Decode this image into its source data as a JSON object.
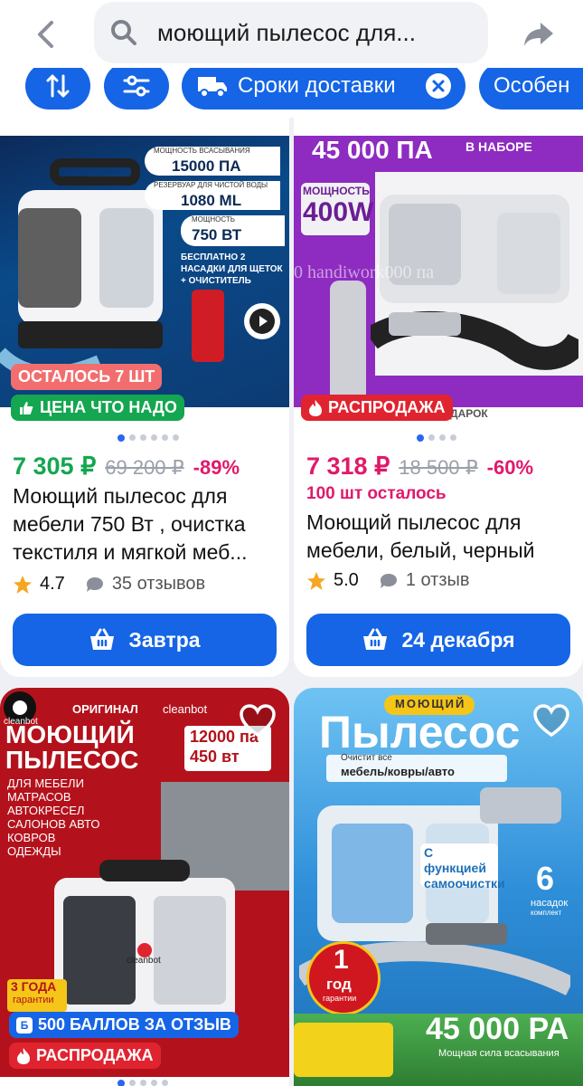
{
  "search": {
    "query": "моющий пылесос для..."
  },
  "filters": [
    {
      "label": ""
    },
    {
      "label": ""
    },
    {
      "label": "Сроки доставки"
    },
    {
      "label": "Особен"
    }
  ],
  "products": [
    {
      "image_texts": {
        "suction_label": "МОЩНОСТЬ ВСАСЫВАНИЯ",
        "suction": "15000 ПА",
        "tank_label": "РЕЗЕРВУАР ДЛЯ ЧИСТОЙ ВОДЫ",
        "tank": "1080 ML",
        "power_label": "МОЩНОСТЬ",
        "power": "750 ВТ",
        "bonus": "БЕСПЛАТНО 2 НАСАДКИ ДЛЯ ЩЕТОК + ОЧИСТИТЕЛЬ"
      },
      "badge_top": "ОСТАЛОСЬ 7 ШТ",
      "badge_bottom": "ЦЕНА ЧТО НАДО",
      "price": "7 305 ₽",
      "old_price": "69 200 ₽",
      "discount": "-89%",
      "title": "Моющий пылесос для мебели 750 Вт , очистка текстиля и мягкой меб...",
      "rating": "4.7",
      "reviews": "35 отзывов",
      "delivery": "Завтра"
    },
    {
      "image_texts": {
        "pressure": "45 000 ПА",
        "set": "В НАБОРЕ",
        "power_label": "МОЩНОСТЬ",
        "power": "400W",
        "watermark": "000 handiwork000 па",
        "gift": "МОЮЩЕЕ СРЕДСТВО В ПОДАРОК"
      },
      "badge_bottom": "РАСПРОДАЖА",
      "price": "7 318 ₽",
      "old_price": "18 500 ₽",
      "discount": "-60%",
      "stock": "100 шт осталось",
      "title": "Моющий пылесос для мебели, белый, черный",
      "rating": "5.0",
      "reviews": "1 отзыв",
      "delivery": "24 декабря"
    },
    {
      "image_texts": {
        "brand": "cleanbot",
        "original": "ОРИГИНАЛ",
        "brand2": "cleanbot",
        "title": "МОЮЩИЙ ПЫЛЕСОС",
        "pa": "12000 па",
        "watt": "450 вт",
        "uses": [
          "ДЛЯ МЕБЕЛИ",
          "МАТРАСОВ",
          "АВТОКРЕСЕЛ",
          "САЛОНОВ АВТО",
          "КОВРОВ",
          "ОДЕЖДЫ"
        ],
        "warranty": "3 ГОДА",
        "warranty_sub": "гарантии",
        "device_brand": "cleanbot"
      },
      "badge_points": "500 БАЛЛОВ ЗА ОТЗЫВ",
      "badge_sale": "РАСПРОДАЖА"
    },
    {
      "image_texts": {
        "word1": "МОЮЩИЙ",
        "word2": "Пылесос",
        "cleans": "Очистит все",
        "cleans_what": "мебель/ковры/авто",
        "self_clean": "С функцией самоочистки",
        "nozzles_num": "6",
        "nozzles": "насадок",
        "nozzles_sub": "комплект",
        "year": "1",
        "year_word": "год",
        "year_sub": "гарантии",
        "pressure": "45 000 PA",
        "pressure_sub": "Мощная сила всасывания"
      }
    }
  ],
  "colors": {
    "accent": "#1565e6",
    "green": "#14a650",
    "sale_red": "#e0242f",
    "discount": "#e0196b"
  }
}
